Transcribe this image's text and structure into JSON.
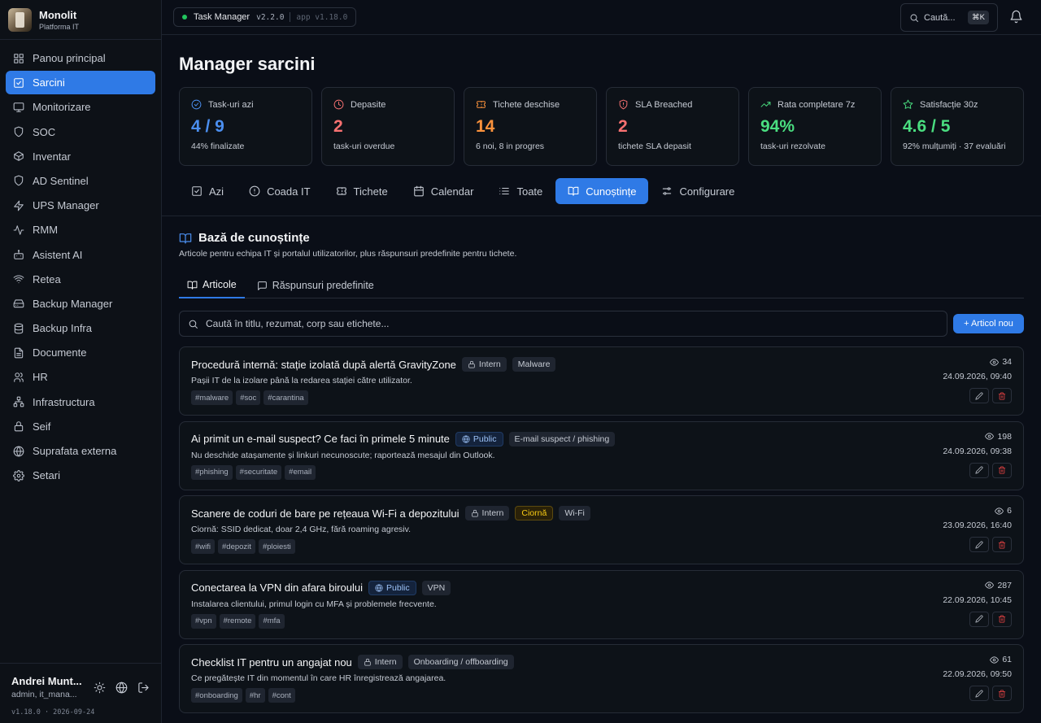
{
  "brand": {
    "name": "Monolit",
    "subtitle": "Platforma IT"
  },
  "sidebar": {
    "items": [
      {
        "label": "Panou principal",
        "icon": "dashboard-icon"
      },
      {
        "label": "Sarcini",
        "icon": "task-check-icon",
        "active": true
      },
      {
        "label": "Monitorizare",
        "icon": "monitor-icon"
      },
      {
        "label": "SOC",
        "icon": "shield-icon"
      },
      {
        "label": "Inventar",
        "icon": "box-icon"
      },
      {
        "label": "AD Sentinel",
        "icon": "shield-icon"
      },
      {
        "label": "UPS Manager",
        "icon": "bolt-icon"
      },
      {
        "label": "RMM",
        "icon": "pulse-icon"
      },
      {
        "label": "Asistent AI",
        "icon": "bot-icon"
      },
      {
        "label": "Retea",
        "icon": "wifi-icon"
      },
      {
        "label": "Backup Manager",
        "icon": "drive-icon"
      },
      {
        "label": "Backup Infra",
        "icon": "database-icon"
      },
      {
        "label": "Documente",
        "icon": "document-icon"
      },
      {
        "label": "HR",
        "icon": "users-icon"
      },
      {
        "label": "Infrastructura",
        "icon": "network-icon"
      },
      {
        "label": "Seif",
        "icon": "lock-icon"
      },
      {
        "label": "Suprafata externa",
        "icon": "globe-icon"
      },
      {
        "label": "Setari",
        "icon": "gear-icon"
      }
    ],
    "user": {
      "name": "Andrei Munt...",
      "role": "admin, it_mana..."
    },
    "version": "v1.18.0 · 2026-09-24"
  },
  "topbar": {
    "app_name": "Task Manager",
    "app_version": "v2.2.0",
    "platform_version": "app v1.18.0",
    "search_label": "Caută...",
    "search_shortcut": "⌘K"
  },
  "page": {
    "title": "Manager sarcini"
  },
  "stats": [
    {
      "label": "Task-uri azi",
      "value": "4 / 9",
      "sub": "44% finalizate",
      "color": "#4b8ff0",
      "icon": "check-circle-icon"
    },
    {
      "label": "Depasite",
      "value": "2",
      "sub": "task-uri overdue",
      "color": "#f87171",
      "icon": "clock-icon"
    },
    {
      "label": "Tichete deschise",
      "value": "14",
      "sub": "6 noi, 8 in progres",
      "color": "#fb923c",
      "icon": "ticket-icon"
    },
    {
      "label": "SLA Breached",
      "value": "2",
      "sub": "tichete SLA depasit",
      "color": "#f87171",
      "icon": "shield-alert-icon"
    },
    {
      "label": "Rata completare 7z",
      "value": "94%",
      "sub": "task-uri rezolvate",
      "color": "#4ade80",
      "icon": "trend-up-icon"
    },
    {
      "label": "Satisfacție 30z",
      "value": "4.6 / 5",
      "sub": "92% mulțumiți · 37 evaluări",
      "color": "#4ade80",
      "icon": "star-icon"
    }
  ],
  "tabs": [
    {
      "label": "Azi",
      "icon": "checkbox-icon"
    },
    {
      "label": "Coada IT",
      "icon": "alert-circle-icon"
    },
    {
      "label": "Tichete",
      "icon": "ticket-icon"
    },
    {
      "label": "Calendar",
      "icon": "calendar-icon"
    },
    {
      "label": "Toate",
      "icon": "list-icon"
    },
    {
      "label": "Cunoștințe",
      "icon": "book-icon",
      "active": true
    },
    {
      "label": "Configurare",
      "icon": "sliders-icon"
    }
  ],
  "kb": {
    "title": "Bază de cunoștințe",
    "subtitle": "Articole pentru echipa IT și portalul utilizatorilor, plus răspunsuri predefinite pentru tichete.",
    "subtabs": [
      {
        "label": "Articole",
        "icon": "book-icon",
        "active": true
      },
      {
        "label": "Răspunsuri predefinite",
        "icon": "message-icon"
      }
    ],
    "search_placeholder": "Caută în titlu, rezumat, corp sau etichete...",
    "new_button": "+ Articol nou"
  },
  "articles": [
    {
      "title": "Procedură internă: stație izolată după alertă GravityZone",
      "badges": [
        {
          "text": "Intern",
          "kind": "internal"
        },
        {
          "text": "Malware",
          "kind": "category"
        }
      ],
      "desc": "Pașii IT de la izolare până la redarea stației către utilizator.",
      "tags": [
        "#malware",
        "#soc",
        "#carantina"
      ],
      "views": "34",
      "date": "24.09.2026, 09:40"
    },
    {
      "title": "Ai primit un e-mail suspect? Ce faci în primele 5 minute",
      "badges": [
        {
          "text": "Public",
          "kind": "public"
        },
        {
          "text": "E-mail suspect / phishing",
          "kind": "category"
        }
      ],
      "desc": "Nu deschide atașamente și linkuri necunoscute; raportează mesajul din Outlook.",
      "tags": [
        "#phishing",
        "#securitate",
        "#email"
      ],
      "views": "198",
      "date": "24.09.2026, 09:38"
    },
    {
      "title": "Scanere de coduri de bare pe rețeaua Wi-Fi a depozitului",
      "badges": [
        {
          "text": "Intern",
          "kind": "internal"
        },
        {
          "text": "Ciornă",
          "kind": "draft"
        },
        {
          "text": "Wi-Fi",
          "kind": "category"
        }
      ],
      "desc": "Ciornă: SSID dedicat, doar 2,4 GHz, fără roaming agresiv.",
      "tags": [
        "#wifi",
        "#depozit",
        "#ploiesti"
      ],
      "views": "6",
      "date": "23.09.2026, 16:40"
    },
    {
      "title": "Conectarea la VPN din afara biroului",
      "badges": [
        {
          "text": "Public",
          "kind": "public"
        },
        {
          "text": "VPN",
          "kind": "category"
        }
      ],
      "desc": "Instalarea clientului, primul login cu MFA și problemele frecvente.",
      "tags": [
        "#vpn",
        "#remote",
        "#mfa"
      ],
      "views": "287",
      "date": "22.09.2026, 10:45"
    },
    {
      "title": "Checklist IT pentru un angajat nou",
      "badges": [
        {
          "text": "Intern",
          "kind": "internal"
        },
        {
          "text": "Onboarding / offboarding",
          "kind": "category"
        }
      ],
      "desc": "Ce pregătește IT din momentul în care HR înregistrează angajarea.",
      "tags": [
        "#onboarding",
        "#hr",
        "#cont"
      ],
      "views": "61",
      "date": "22.09.2026, 09:50"
    }
  ]
}
